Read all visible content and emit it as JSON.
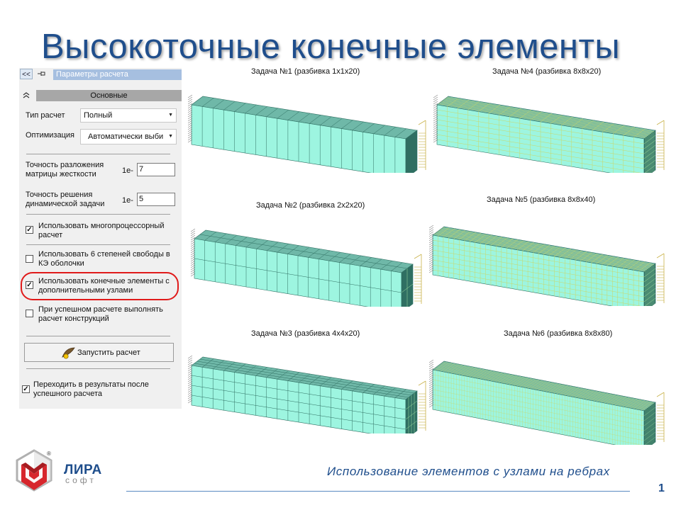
{
  "slide": {
    "title": "Высокоточные конечные элементы",
    "caption": "Использование элементов с узлами на ребрах",
    "page_number": "1"
  },
  "panel": {
    "collapse_label": "<<",
    "title": "Параметры расчета",
    "section": "Основные",
    "calc_type": {
      "label": "Тип расчет",
      "value": "Полный"
    },
    "optimization": {
      "label": "Оптимизация",
      "value": "Автоматически выби"
    },
    "matrix_precision": {
      "label": "Точность разложения матрицы жесткости",
      "prefix": "1e-",
      "value": "7"
    },
    "dynamic_precision": {
      "label": "Точность решения динамической задачи",
      "prefix": "1e-",
      "value": "5"
    },
    "multiproc": {
      "label": "Использовать многопроцессорный расчет",
      "checked": true
    },
    "six_dof": {
      "label": "Использовать 6 степеней свободы в КЭ оболочки",
      "checked": false
    },
    "extra_nodes": {
      "label": "Использовать конечные элементы с дополнительными узлами",
      "checked": true
    },
    "design_after": {
      "label": "При успешном расчете выполнять расчет конструкций",
      "checked": false
    },
    "run_button": "Запустить расчет",
    "goto_results": {
      "label": "Переходить в результаты после успешного расчета",
      "checked": true
    }
  },
  "tasks": [
    {
      "label": "Задача №1 (разбивка 1x1x20)",
      "divisions": [
        1,
        1,
        20
      ]
    },
    {
      "label": "Задача №2 (разбивка 2x2x20)",
      "divisions": [
        2,
        2,
        20
      ]
    },
    {
      "label": "Задача №3 (разбивка 4x4x20)",
      "divisions": [
        4,
        4,
        20
      ]
    },
    {
      "label": "Задача №4 (разбивка 8x8x20)",
      "divisions": [
        8,
        8,
        20
      ]
    },
    {
      "label": "Задача №5 (разбивка 8x8x40)",
      "divisions": [
        8,
        8,
        40
      ]
    },
    {
      "label": "Задача №6 (разбивка 8x8x80)",
      "divisions": [
        8,
        8,
        80
      ]
    }
  ],
  "logo": {
    "name": "ЛИРА",
    "sub": "софт",
    "reg": "®"
  },
  "colors": {
    "title": "#1f4e8c",
    "mesh_fill": "#9df5e0",
    "mesh_top": "#6fb8a8",
    "mesh_dark": "#2f6f62",
    "highlight": "#e01a1a"
  }
}
